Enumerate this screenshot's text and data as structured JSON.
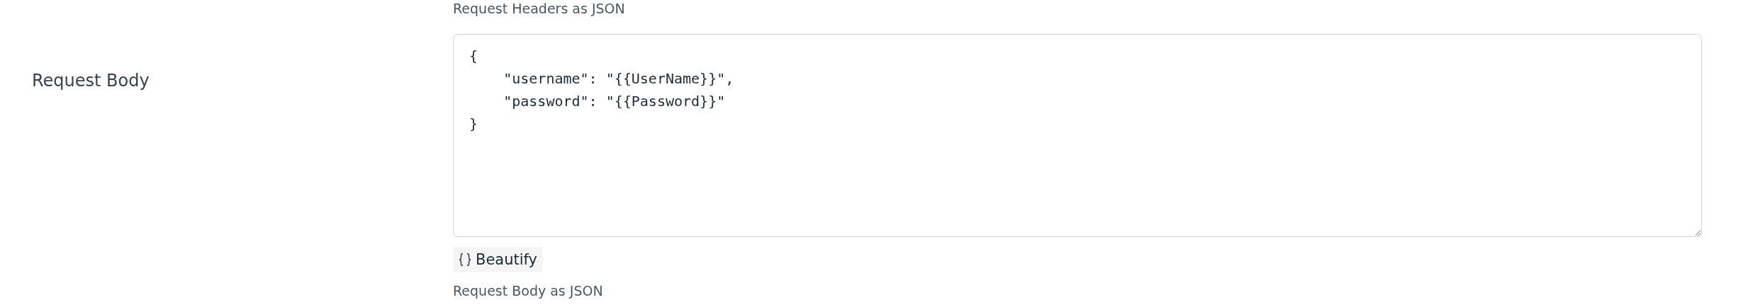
{
  "request_headers": {
    "hint": "Request Headers as JSON"
  },
  "request_body": {
    "label": "Request Body",
    "value": "{\n    \"username\": \"{{UserName}}\",\n    \"password\": \"{{Password}}\"\n}",
    "button": "Beautify",
    "hint": "Request Body as JSON"
  }
}
